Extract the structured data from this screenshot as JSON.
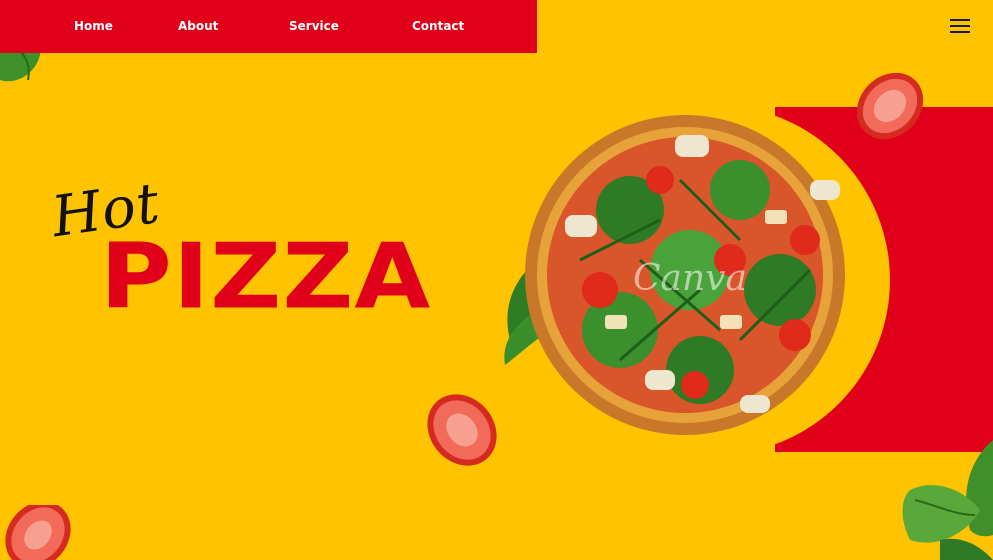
{
  "nav": {
    "items": [
      {
        "label": "Home"
      },
      {
        "label": "About"
      },
      {
        "label": "Service"
      },
      {
        "label": "Contact"
      }
    ]
  },
  "hero": {
    "script_word": "Hot",
    "title": "PIZZA"
  },
  "watermark": "Canva",
  "icons": {
    "menu": "hamburger-menu-icon"
  },
  "colors": {
    "background": "#ffc300",
    "accent_red": "#e0001a",
    "text_dark": "#111111",
    "nav_text": "#ffffff"
  }
}
